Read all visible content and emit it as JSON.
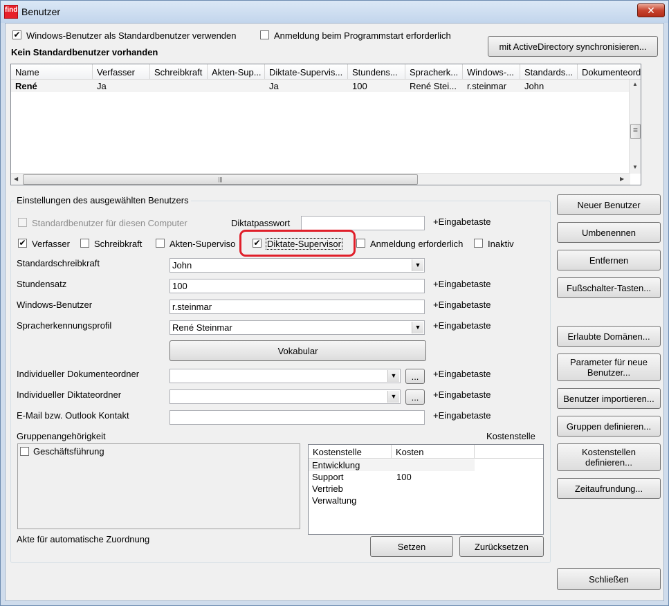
{
  "window": {
    "title": "Benutzer",
    "app_icon_text": "find",
    "close_glyph": "✕"
  },
  "top": {
    "use_windows_user_label": "Windows-Benutzer als Standardbenutzer verwenden",
    "use_windows_user_checked": true,
    "login_required_label": "Anmeldung beim Programmstart erforderlich",
    "login_required_checked": false,
    "no_default_user_text": "Kein Standardbenutzer vorhanden",
    "sync_ad_button": "mit ActiveDirectory synchronisieren..."
  },
  "user_table": {
    "columns": [
      "Name",
      "Verfasser",
      "Schreibkraft",
      "Akten-Sup...",
      "Diktate-Supervis...",
      "Stundens...",
      "Spracherk...",
      "Windows-...",
      "Standards...",
      "Dokumenteord"
    ],
    "rows": [
      [
        "René",
        "Ja",
        "",
        "",
        "Ja",
        "100",
        "René Stei...",
        "r.steinmar",
        "John",
        ""
      ]
    ],
    "scroll_glyphs": {
      "up": "▲",
      "down": "▼",
      "left": "◀",
      "right": "▶",
      "grip_v": "☰",
      "grip_h": "|||"
    }
  },
  "settings": {
    "group_title": "Einstellungen des ausgewählten Benutzers",
    "default_user_pc_label": "Standardbenutzer für diesen Computer",
    "diktatpasswort_label": "Diktatpasswort",
    "enter_hint": "+Eingabetaste",
    "roles": {
      "verfasser_label": "Verfasser",
      "verfasser_checked": true,
      "schreibkraft_label": "Schreibkraft",
      "schreibkraft_checked": false,
      "akten_label": "Akten-Superviso",
      "akten_checked": false,
      "diktate_label": "Diktate-Supervisor",
      "diktate_checked": true,
      "anmeldung_label": "Anmeldung erforderlich",
      "anmeldung_checked": false,
      "inaktiv_label": "Inaktiv",
      "inaktiv_checked": false
    },
    "standardschreibkraft_label": "Standardschreibkraft",
    "standardschreibkraft_value": "John",
    "stundensatz_label": "Stundensatz",
    "stundensatz_value": "100",
    "windows_user_label": "Windows-Benutzer",
    "windows_user_value": "r.steinmar",
    "speech_profile_label": "Spracherkennungsprofil",
    "speech_profile_value": "René Steinmar",
    "vokabular_button": "Vokabular",
    "doc_folder_label": "Individueller Dokumenteordner",
    "doc_folder_value": "",
    "dictation_folder_label": "Individueller Diktateordner",
    "dictation_folder_value": "",
    "browse_button": "...",
    "email_label": "E-Mail bzw. Outlook Kontakt",
    "email_value": "",
    "group_membership_label": "Gruppenangehörigkeit",
    "groups": [
      {
        "label": "Geschäftsführung",
        "checked": false
      }
    ],
    "cost_center_label": "Kostenstelle",
    "cost_columns": [
      "Kostenstelle",
      "Kosten"
    ],
    "cost_rows": [
      [
        "Entwicklung",
        ""
      ],
      [
        "Support",
        "100"
      ],
      [
        "Vertrieb",
        ""
      ],
      [
        "Verwaltung",
        ""
      ]
    ],
    "auto_assign_label": "Akte für automatische Zuordnung",
    "set_button": "Setzen",
    "reset_button": "Zurücksetzen"
  },
  "side_buttons": {
    "new_user": "Neuer Benutzer",
    "rename": "Umbenennen",
    "remove": "Entfernen",
    "foot_switch": "Fußschalter-Tasten...",
    "allowed_domains": "Erlaubte Domänen...",
    "new_user_params": "Parameter für neue Benutzer...",
    "import_users": "Benutzer importieren...",
    "define_groups": "Gruppen definieren...",
    "define_cost_centers": "Kostenstellen definieren...",
    "time_rounding": "Zeitaufrundung...",
    "close": "Schließen"
  },
  "colors": {
    "highlight": "#e01f2a",
    "app_icon": "#e8202a"
  }
}
